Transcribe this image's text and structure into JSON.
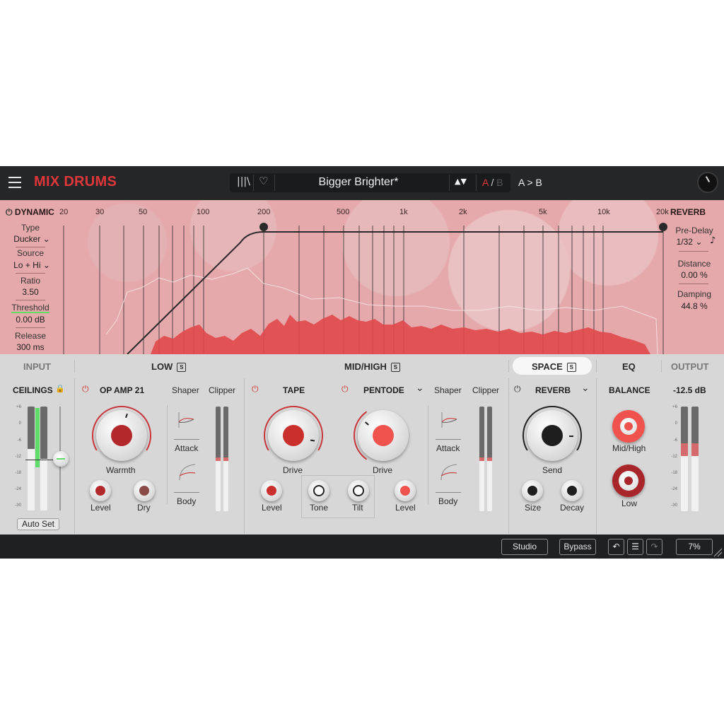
{
  "header": {
    "title": "MIX DRUMS",
    "preset": "Bigger Brighter*",
    "ab_a": "A",
    "ab_slash": "/",
    "ab_b": "B",
    "a_to_b": "A > B",
    "prev_next": "▲▼"
  },
  "display": {
    "dynamic_label": "DYNAMIC",
    "reverb_label": "REVERB",
    "freq_labels": [
      "20",
      "30",
      "50",
      "100",
      "200",
      "500",
      "1k",
      "2k",
      "5k",
      "10k",
      "20k"
    ],
    "dynamic_params": [
      {
        "label": "Type",
        "value": "Ducker ⌄"
      },
      {
        "label": "Source",
        "value": "Lo + Hi ⌄"
      },
      {
        "label": "Ratio",
        "value": "3.50"
      },
      {
        "label": "Threshold",
        "value": "0.00 dB"
      },
      {
        "label": "Release",
        "value": "300 ms"
      }
    ],
    "reverb_params": [
      {
        "label": "Pre-Delay",
        "value": "1/32 ⌄"
      },
      {
        "label": "Distance",
        "value": "0.00 %"
      },
      {
        "label": "Damping",
        "value": "44.8 %"
      }
    ]
  },
  "sections": {
    "input": "INPUT",
    "low": "LOW",
    "midhigh": "MID/HIGH",
    "space": "SPACE",
    "eq": "EQ",
    "output": "OUTPUT",
    "solo": "S"
  },
  "ceilings": {
    "title": "CEILINGS",
    "scale": [
      "+6",
      "0",
      "-6",
      "-12",
      "-18",
      "-24",
      "-30"
    ],
    "auto_set": "Auto Set"
  },
  "low": {
    "module": "OP AMP 21",
    "shaper": "Shaper",
    "clipper": "Clipper",
    "warmth": "Warmth",
    "level": "Level",
    "dry": "Dry",
    "attack": "Attack",
    "body": "Body"
  },
  "midhigh": {
    "tape": "TAPE",
    "pentode": "PENTODE",
    "shaper": "Shaper",
    "clipper": "Clipper",
    "drive1": "Drive",
    "drive2": "Drive",
    "level1": "Level",
    "tone": "Tone",
    "tilt": "Tilt",
    "level2": "Level",
    "attack": "Attack",
    "body": "Body"
  },
  "space": {
    "reverb": "REVERB",
    "send": "Send",
    "size": "Size",
    "decay": "Decay"
  },
  "output": {
    "balance": "BALANCE",
    "gain": "-12.5 dB",
    "midhigh": "Mid/High",
    "low": "Low"
  },
  "bottom": {
    "studio": "Studio",
    "bypass": "Bypass",
    "zoom": "7%"
  },
  "colors": {
    "brand": "#e0373a",
    "spectrum": "#e0484b",
    "panel": "#d7d7d8",
    "meter_green": "#5fdc6a"
  },
  "icons": [
    "menu-icon",
    "library-icon",
    "heart-icon",
    "power-icon",
    "lock-icon",
    "chevron-down-icon",
    "note-icon",
    "undo-icon",
    "list-icon",
    "redo-icon",
    "resize-icon"
  ]
}
